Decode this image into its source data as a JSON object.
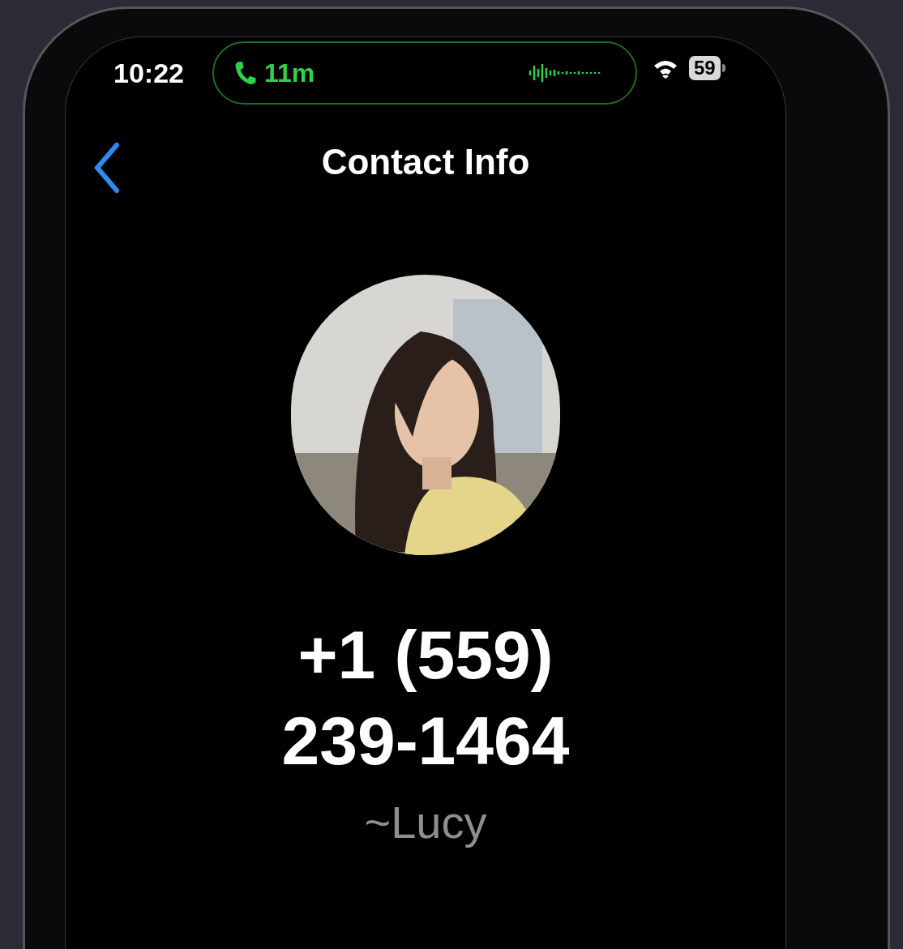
{
  "status_bar": {
    "time": "10:22",
    "call_duration": "11m",
    "battery": "59"
  },
  "header": {
    "title": "Contact Info"
  },
  "contact": {
    "phone_number": "+1 (559) 239-1464",
    "nickname": "~Lucy"
  }
}
